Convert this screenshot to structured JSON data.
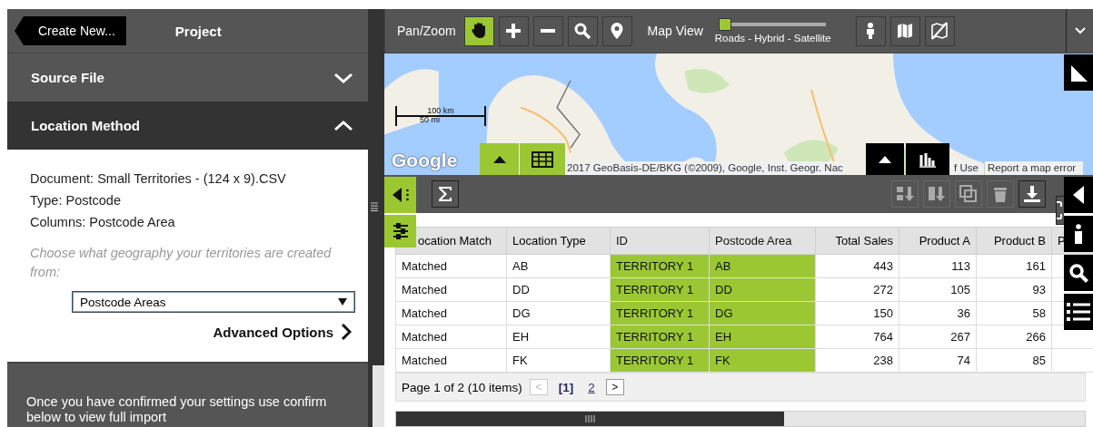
{
  "header": {
    "create_button": "Create New...",
    "title": "Project"
  },
  "sections": [
    {
      "title": "Source File",
      "expanded": false
    },
    {
      "title": "Location Method",
      "expanded": true
    }
  ],
  "details": [
    "Document: Small Territories - (124 x 9).CSV",
    "Type: Postcode",
    "Columns: Postcode Area"
  ],
  "hint": "Choose what geography your territories are created from:",
  "geography_select": {
    "value": "Postcode Areas"
  },
  "advanced_link": "Advanced Options",
  "footer_text": "Once you have confirmed your settings use confirm below to view full import",
  "toolbar": {
    "pan_label": "Pan/Zoom",
    "tools": [
      {
        "kind": "hand",
        "selected": true
      },
      {
        "kind": "plus",
        "selected": false
      },
      {
        "kind": "minus",
        "selected": false
      },
      {
        "kind": "search",
        "selected": false
      },
      {
        "kind": "pin",
        "selected": false
      }
    ],
    "view_label": "Map View",
    "view_slider": {
      "level": 0,
      "caption": "Roads - Hybrid - Satellite"
    },
    "view_tools": [
      {
        "kind": "person"
      },
      {
        "kind": "map"
      },
      {
        "kind": "nomap"
      }
    ]
  },
  "map": {
    "kind": "picture",
    "scale_top": "100 km",
    "scale_bottom": "50 mi",
    "logo": "Google",
    "attribution": "2017 GeoBasis-DE/BKG (©2009), Google, Inst. Geogr. Nac",
    "terms": "f Use",
    "report": "Report a map error"
  },
  "grid_toolbar": {
    "left": [
      {
        "kind": "sigma",
        "disabled": false
      }
    ],
    "right": [
      {
        "kind": "checkdown",
        "disabled": true
      },
      {
        "kind": "down",
        "disabled": true
      },
      {
        "kind": "copy",
        "disabled": true
      },
      {
        "kind": "trash",
        "disabled": true
      },
      {
        "kind": "download",
        "disabled": false
      }
    ]
  },
  "table": {
    "columns": [
      {
        "label": "ocation Match",
        "kind": "text",
        "highlighted": false
      },
      {
        "label": "Location Type",
        "kind": "text",
        "highlighted": false
      },
      {
        "label": "ID",
        "kind": "text",
        "highlighted": true
      },
      {
        "label": "Postcode Area",
        "kind": "text",
        "highlighted": true
      },
      {
        "label": "Total Sales",
        "kind": "number",
        "highlighted": false
      },
      {
        "label": "Product A",
        "kind": "number",
        "highlighted": false
      },
      {
        "label": "Product B",
        "kind": "number",
        "highlighted": false
      },
      {
        "label": "P",
        "kind": "text",
        "highlighted": false
      }
    ],
    "rows": [
      [
        "Matched",
        "AB",
        "TERRITORY 1",
        "AB",
        "443",
        "113",
        "161"
      ],
      [
        "Matched",
        "DD",
        "TERRITORY 1",
        "DD",
        "272",
        "105",
        "93"
      ],
      [
        "Matched",
        "DG",
        "TERRITORY 1",
        "DG",
        "150",
        "36",
        "58"
      ],
      [
        "Matched",
        "EH",
        "TERRITORY 1",
        "EH",
        "764",
        "267",
        "266"
      ],
      [
        "Matched",
        "FK",
        "TERRITORY 1",
        "FK",
        "238",
        "74",
        "85"
      ]
    ]
  },
  "pager": {
    "summary": "Page 1 of 2 (10 items)",
    "prev": "<",
    "next": ">",
    "pages": [
      {
        "label": "[1]",
        "selected": true
      },
      {
        "label": "2",
        "selected": false
      }
    ]
  }
}
